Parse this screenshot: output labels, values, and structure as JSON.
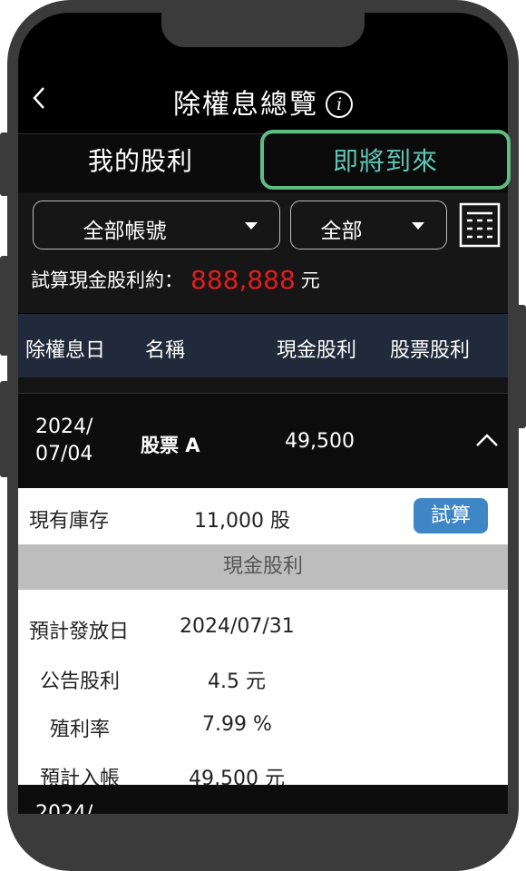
{
  "header": {
    "title": "除權息總覽",
    "info_icon": "i"
  },
  "tabs": [
    {
      "label": "我的股利",
      "active": false
    },
    {
      "label": "即將到來",
      "active": true
    }
  ],
  "filters": {
    "account": "全部帳號",
    "type": "全部"
  },
  "estimate": {
    "label": "試算現金股利約：",
    "amount": "888,888",
    "unit": "元"
  },
  "columns": [
    "除權息日",
    "名稱",
    "現金股利",
    "股票股利"
  ],
  "rows": [
    {
      "date_line1": "2024/",
      "date_line2": "07/04",
      "name": "股票 A",
      "cash_dividend": "49,500",
      "expanded": true,
      "detail": {
        "holding_label": "現有庫存",
        "holding_value": "11,000 股",
        "calc_button": "試算",
        "section_title": "現金股利",
        "items": [
          {
            "label": "預計發放日",
            "value": "2024/07/31"
          },
          {
            "label": "公告股利",
            "value": "4.5 元"
          },
          {
            "label": "殖利率",
            "value": "7.99 %"
          },
          {
            "label": "預計入帳",
            "value": "49,500 元"
          }
        ]
      }
    },
    {
      "date_line1": "2024/"
    }
  ],
  "colors": {
    "accent_teal": "#5fc6b4",
    "highlight_green": "#5fbd81",
    "amount_red": "#e21d1d",
    "calc_button_blue": "#3f86c7",
    "header_navy": "#212a3a"
  }
}
